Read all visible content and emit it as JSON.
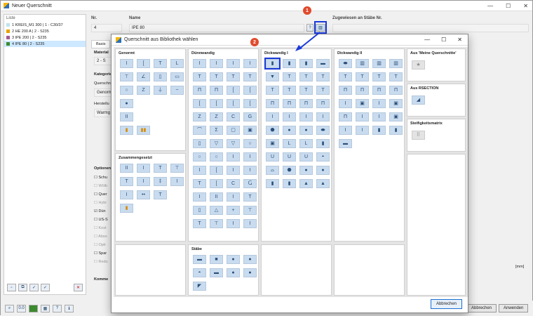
{
  "window": {
    "title": "Neuer Querschnitt"
  },
  "list": {
    "header": "Liste",
    "items": [
      {
        "text": "1  KREIS_M1 300 | 1 - C30/37",
        "color": "#bfe3ef"
      },
      {
        "text": "2  HE 200 A | 2 - S235",
        "color": "#e8a100"
      },
      {
        "text": "3  IPE 200 | 2 - S235",
        "color": "#a35a94"
      },
      {
        "text": "4  IPE 80 | 2 - S235",
        "color": "#3b8a2e"
      }
    ]
  },
  "fields": {
    "nr_label": "Nr.",
    "nr_value": "4",
    "name_label": "Name",
    "name_value": "IPE 80",
    "read_label": "Zugewiesen an Stäbe Nr.",
    "tab_basis": "Basis",
    "material_label": "Material",
    "material_value": "2 - S",
    "kategorie_label": "Kategorie",
    "querschnitt_label": "Querschn",
    "genormt_value": "Genorm",
    "hersteller_label": "Herstellu",
    "warmg_value": "Warmg",
    "optionen_label": "Optionen",
    "kommentar_label": "Komme",
    "unit_label": "[mm]"
  },
  "options": [
    "Schu",
    "Wölb",
    "Quer",
    "Hybr",
    "Dün",
    "US-S",
    "Kost",
    "Abso",
    "Opti",
    "Spar",
    "Redu"
  ],
  "dialog": {
    "title": "Querschnitt aus Bibliothek wählen",
    "cancel": "Abbrechen",
    "groups": {
      "genormt": "Genormt",
      "zusammengesetzt": "Zusammengesetzt",
      "duennwandig": "Dünnwandig",
      "staebe": "Stäbe",
      "dickwandig1": "Dickwandig I",
      "dickwandig2": "Dickwandig II",
      "meine": "Aus 'Meine Querschnitte'",
      "rsection": "Aus RSECTION",
      "steifigkeit": "Steifigkeitsmatrix"
    }
  },
  "bottom": {
    "abbrechen": "Abbrechen",
    "anwenden": "Anwenden"
  },
  "callouts": [
    "1",
    "2"
  ],
  "accent": "#1a3ad8"
}
